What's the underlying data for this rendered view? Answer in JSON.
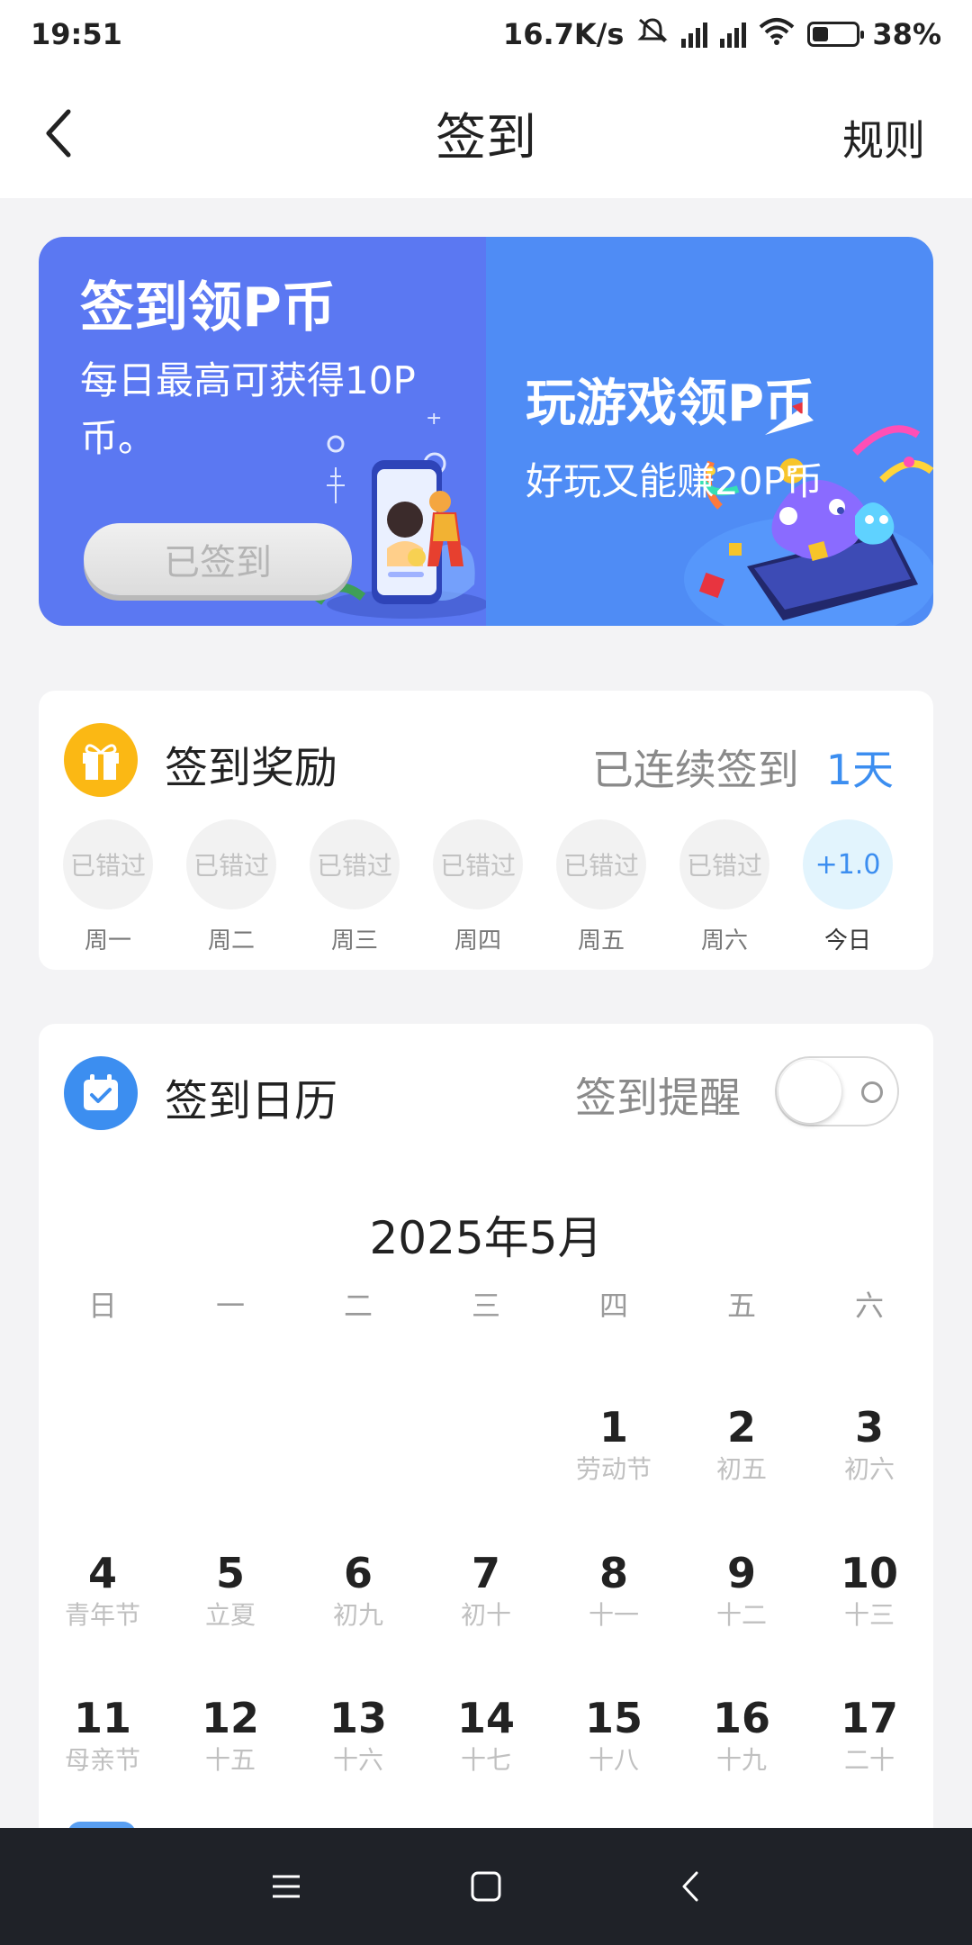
{
  "status_bar": {
    "time": "19:51",
    "net_speed": "16.7K/s",
    "battery": "38%",
    "battery_level": 0.38,
    "icons": [
      "mute-icon",
      "signal-hd-icon",
      "signal-hd-icon",
      "wifi-icon",
      "battery-icon"
    ]
  },
  "nav": {
    "title": "签到",
    "rules_label": "规则",
    "back_icon": "back-arrow-icon"
  },
  "banner": {
    "left_title": "签到领P币",
    "left_subtitle": "每日最高可获得10P币。",
    "signed_button": "已签到",
    "right_title": "玩游戏领P币",
    "right_subtitle": "好玩又能赚20P币"
  },
  "rewards": {
    "heading": "签到奖励",
    "streak_label": "已连续签到",
    "streak_days": "1天",
    "days": [
      {
        "status": "已错过",
        "label": "周一"
      },
      {
        "status": "已错过",
        "label": "周二"
      },
      {
        "status": "已错过",
        "label": "周三"
      },
      {
        "status": "已错过",
        "label": "周四"
      },
      {
        "status": "已错过",
        "label": "周五"
      },
      {
        "status": "已错过",
        "label": "周六"
      },
      {
        "status": "+1.0",
        "label": "今日"
      }
    ]
  },
  "calendar": {
    "heading": "签到日历",
    "reminder_label": "签到提醒",
    "reminder_on": false,
    "month_title": "2025年5月",
    "weekdays": [
      "日",
      "一",
      "二",
      "三",
      "四",
      "五",
      "六"
    ],
    "rows": [
      [
        null,
        null,
        null,
        null,
        {
          "day": "1",
          "sub": "劳动节"
        },
        {
          "day": "2",
          "sub": "初五"
        },
        {
          "day": "3",
          "sub": "初六"
        }
      ],
      [
        {
          "day": "4",
          "sub": "青年节"
        },
        {
          "day": "5",
          "sub": "立夏"
        },
        {
          "day": "6",
          "sub": "初九"
        },
        {
          "day": "7",
          "sub": "初十"
        },
        {
          "day": "8",
          "sub": "十一"
        },
        {
          "day": "9",
          "sub": "十二"
        },
        {
          "day": "10",
          "sub": "十三"
        }
      ],
      [
        {
          "day": "11",
          "sub": "母亲节"
        },
        {
          "day": "12",
          "sub": "十五"
        },
        {
          "day": "13",
          "sub": "十六"
        },
        {
          "day": "14",
          "sub": "十七"
        },
        {
          "day": "15",
          "sub": "十八"
        },
        {
          "day": "16",
          "sub": "十九"
        },
        {
          "day": "17",
          "sub": "二十"
        }
      ]
    ]
  },
  "colors": {
    "accent_blue": "#3c8ef0",
    "banner_left": "#5b78f2",
    "banner_right": "#4f8cf5",
    "gift_yellow": "#fbb814",
    "calendar_blue": "#3c8ef0"
  },
  "system_nav": {
    "icons": [
      "menu-icon",
      "home-icon",
      "back-icon"
    ]
  }
}
